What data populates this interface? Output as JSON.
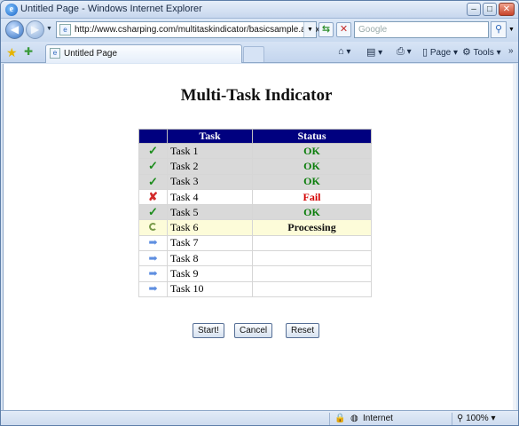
{
  "window": {
    "title": "Untitled Page - Windows Internet Explorer"
  },
  "address": {
    "url": "http://www.csharping.com/multitaskindicator/basicsample.aspx"
  },
  "search": {
    "placeholder": "Google"
  },
  "tab": {
    "label": "Untitled Page"
  },
  "commands": {
    "page": "Page",
    "tools": "Tools"
  },
  "page": {
    "title": "Multi-Task Indicator",
    "table": {
      "headers": [
        "",
        "Task",
        "Status"
      ],
      "rows": [
        {
          "icon": "check-icon",
          "name": "Task 1",
          "status": "OK",
          "state": "done"
        },
        {
          "icon": "check-icon",
          "name": "Task 2",
          "status": "OK",
          "state": "done"
        },
        {
          "icon": "check-icon",
          "name": "Task 3",
          "status": "OK",
          "state": "done"
        },
        {
          "icon": "cross-icon",
          "name": "Task 4",
          "status": "Fail",
          "state": "fail"
        },
        {
          "icon": "check-icon",
          "name": "Task 5",
          "status": "OK",
          "state": "done"
        },
        {
          "icon": "spinner-icon",
          "name": "Task 6",
          "status": "Processing",
          "state": "proc"
        },
        {
          "icon": "arrow-right-icon",
          "name": "Task 7",
          "status": "",
          "state": "pending"
        },
        {
          "icon": "arrow-right-icon",
          "name": "Task 8",
          "status": "",
          "state": "pending"
        },
        {
          "icon": "arrow-right-icon",
          "name": "Task 9",
          "status": "",
          "state": "pending"
        },
        {
          "icon": "arrow-right-icon",
          "name": "Task 10",
          "status": "",
          "state": "pending"
        }
      ]
    },
    "buttons": {
      "start": "Start!",
      "cancel": "Cancel",
      "reset": "Reset"
    }
  },
  "status": {
    "zone": "Internet",
    "zoom": "100%"
  },
  "colors": {
    "header_bg": "#00007f",
    "ok": "#0a7d0a",
    "fail": "#d30000",
    "done_row": "#d9d9d9",
    "proc_row": "#fdfcd9"
  }
}
